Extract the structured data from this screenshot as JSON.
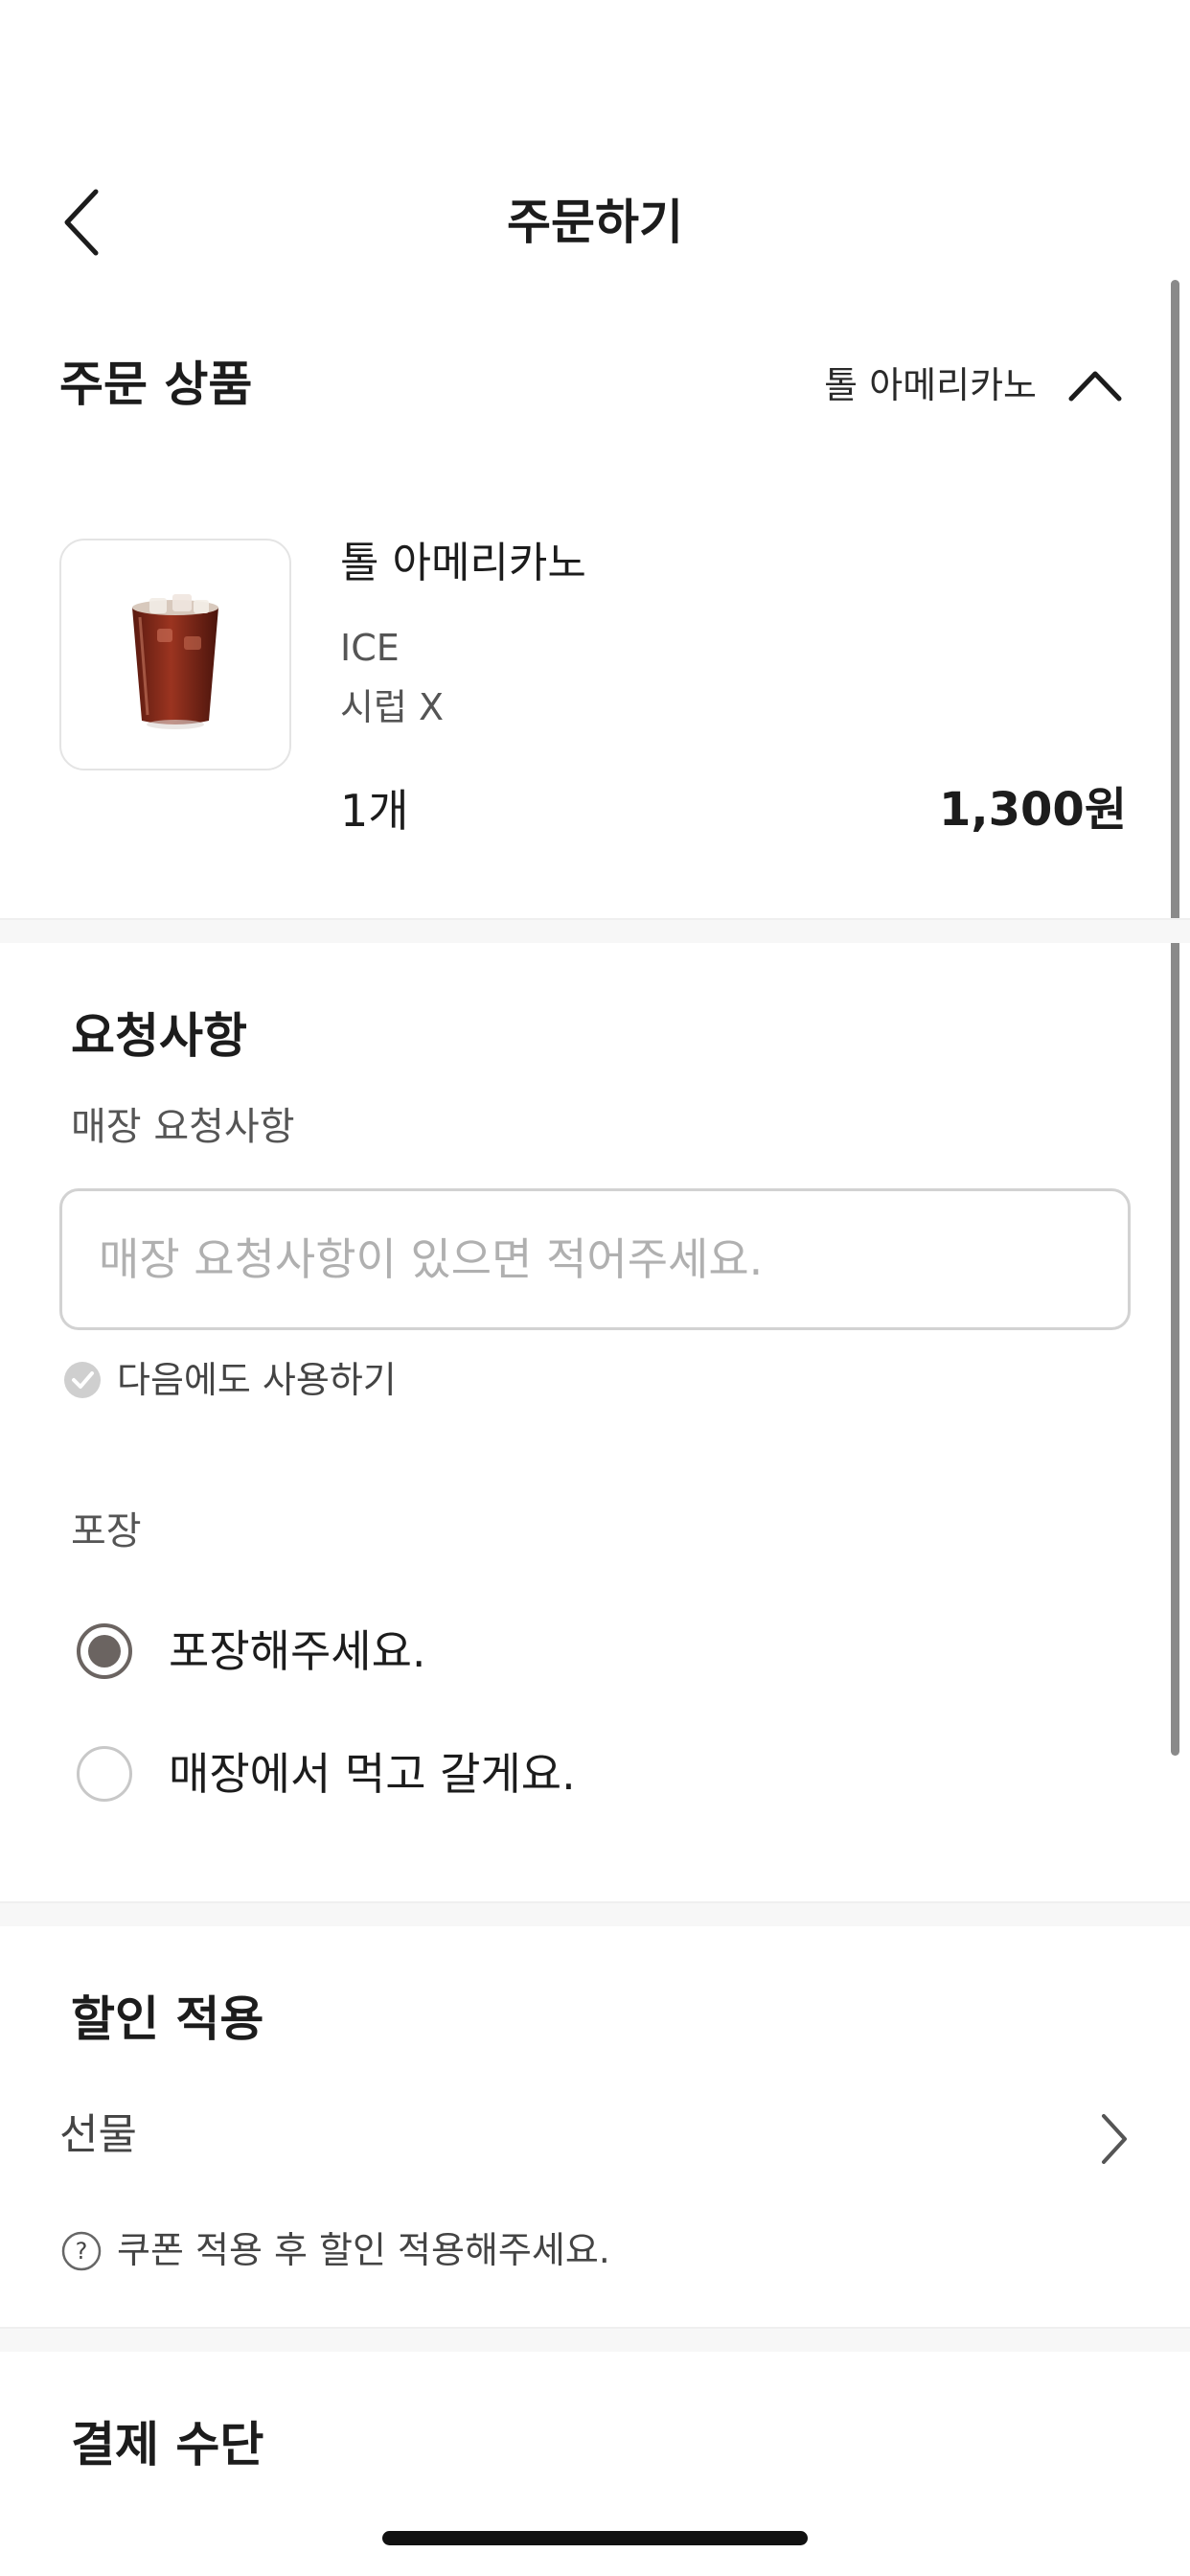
{
  "header": {
    "title": "주문하기",
    "back_icon": "chevron-left-icon"
  },
  "order_items": {
    "title": "주문 상품",
    "summary_name": "톨 아메리카노",
    "toggle_icon": "chevron-up-icon",
    "item": {
      "name": "톨 아메리카노",
      "options": [
        "ICE",
        "시럽 X"
      ],
      "quantity": "1개",
      "price": "1,300원",
      "image": "iced-americano-image"
    }
  },
  "requests": {
    "title": "요청사항",
    "store_request_label": "매장 요청사항",
    "store_request_placeholder": "매장 요청사항이 있으면 적어주세요.",
    "store_request_value": "",
    "save_for_next": {
      "label": "다음에도 사용하기",
      "checked": true,
      "icon": "check-circle-icon"
    },
    "packaging": {
      "label": "포장",
      "options": [
        {
          "label": "포장해주세요.",
          "selected": true
        },
        {
          "label": "매장에서 먹고 갈게요.",
          "selected": false
        }
      ]
    }
  },
  "discount": {
    "title": "할인 적용",
    "gift_label": "선물",
    "gift_icon": "chevron-right-icon",
    "help_icon": "question-circle-icon",
    "help_text": "쿠폰 적용 후 할인 적용해주세요."
  },
  "payment": {
    "title": "결제 수단"
  },
  "colors": {
    "radio_selected": "#6b6461",
    "text_primary": "#1c1c1c",
    "text_secondary": "#555555",
    "placeholder": "#b0b0b0",
    "divider": "#f7f7f7"
  }
}
